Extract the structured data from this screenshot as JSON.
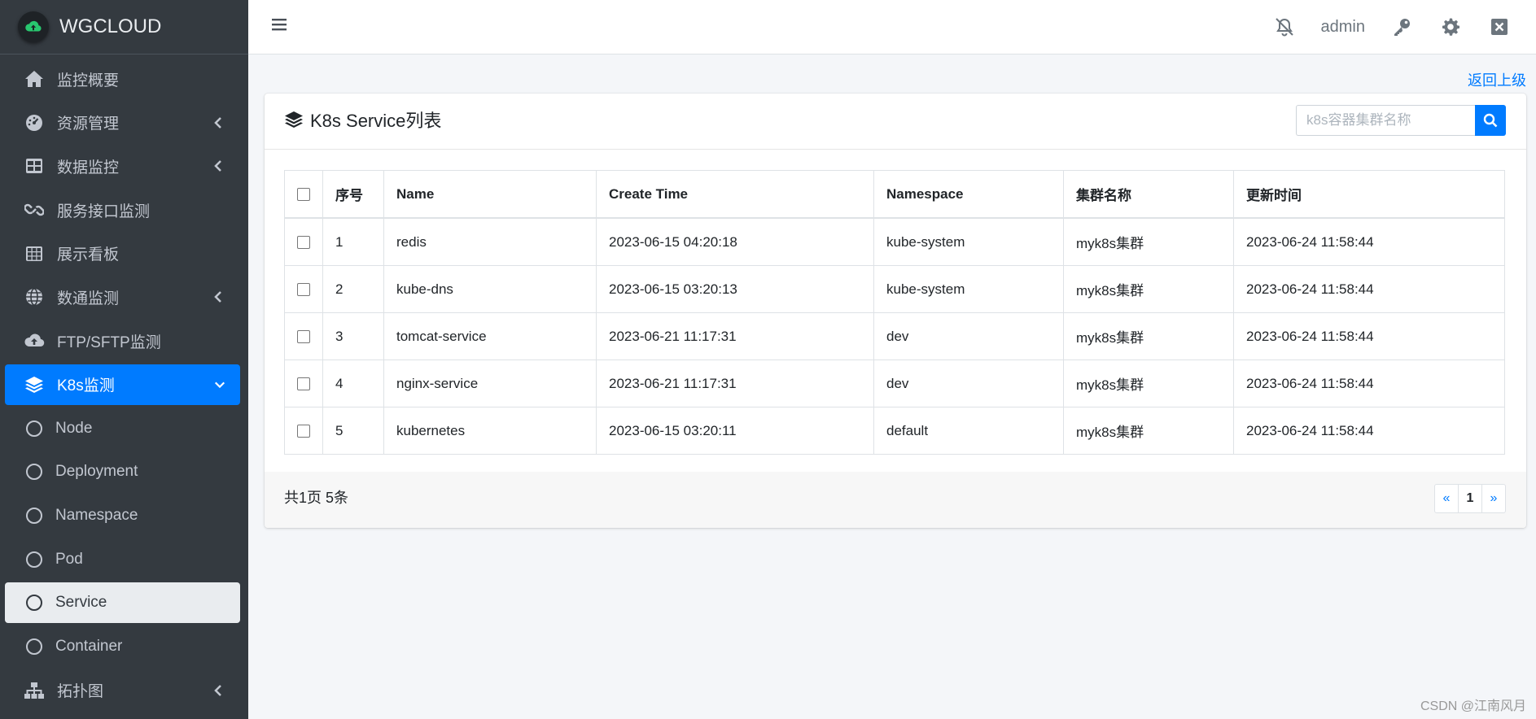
{
  "brand": {
    "name": "WGCLOUD"
  },
  "sidebar": {
    "items": [
      {
        "label": "监控概要"
      },
      {
        "label": "资源管理"
      },
      {
        "label": "数据监控"
      },
      {
        "label": "服务接口监测"
      },
      {
        "label": "展示看板"
      },
      {
        "label": "数通监测"
      },
      {
        "label": "FTP/SFTP监测"
      },
      {
        "label": "K8s监测"
      },
      {
        "label": "Node"
      },
      {
        "label": "Deployment"
      },
      {
        "label": "Namespace"
      },
      {
        "label": "Pod"
      },
      {
        "label": "Service"
      },
      {
        "label": "Container"
      },
      {
        "label": "拓扑图"
      }
    ]
  },
  "header": {
    "user": "admin"
  },
  "content": {
    "back_link": "返回上级",
    "card_title": "K8s Service列表",
    "search_placeholder": "k8s容器集群名称",
    "columns": [
      "序号",
      "Name",
      "Create Time",
      "Namespace",
      "集群名称",
      "更新时间"
    ],
    "rows": [
      [
        "1",
        "redis",
        "2023-06-15 04:20:18",
        "kube-system",
        "myk8s集群",
        "2023-06-24 11:58:44"
      ],
      [
        "2",
        "kube-dns",
        "2023-06-15 03:20:13",
        "kube-system",
        "myk8s集群",
        "2023-06-24 11:58:44"
      ],
      [
        "3",
        "tomcat-service",
        "2023-06-21 11:17:31",
        "dev",
        "myk8s集群",
        "2023-06-24 11:58:44"
      ],
      [
        "4",
        "nginx-service",
        "2023-06-21 11:17:31",
        "dev",
        "myk8s集群",
        "2023-06-24 11:58:44"
      ],
      [
        "5",
        "kubernetes",
        "2023-06-15 03:20:11",
        "default",
        "myk8s集群",
        "2023-06-24 11:58:44"
      ]
    ],
    "footer_text": "共1页 5条",
    "pagination": {
      "prev": "«",
      "current": "1",
      "next": "»"
    }
  },
  "watermark": "CSDN @江南风月",
  "colors": {
    "sidebar_bg": "#343a40",
    "accent": "#007bff",
    "active_sub_bg": "#e9ecef"
  }
}
